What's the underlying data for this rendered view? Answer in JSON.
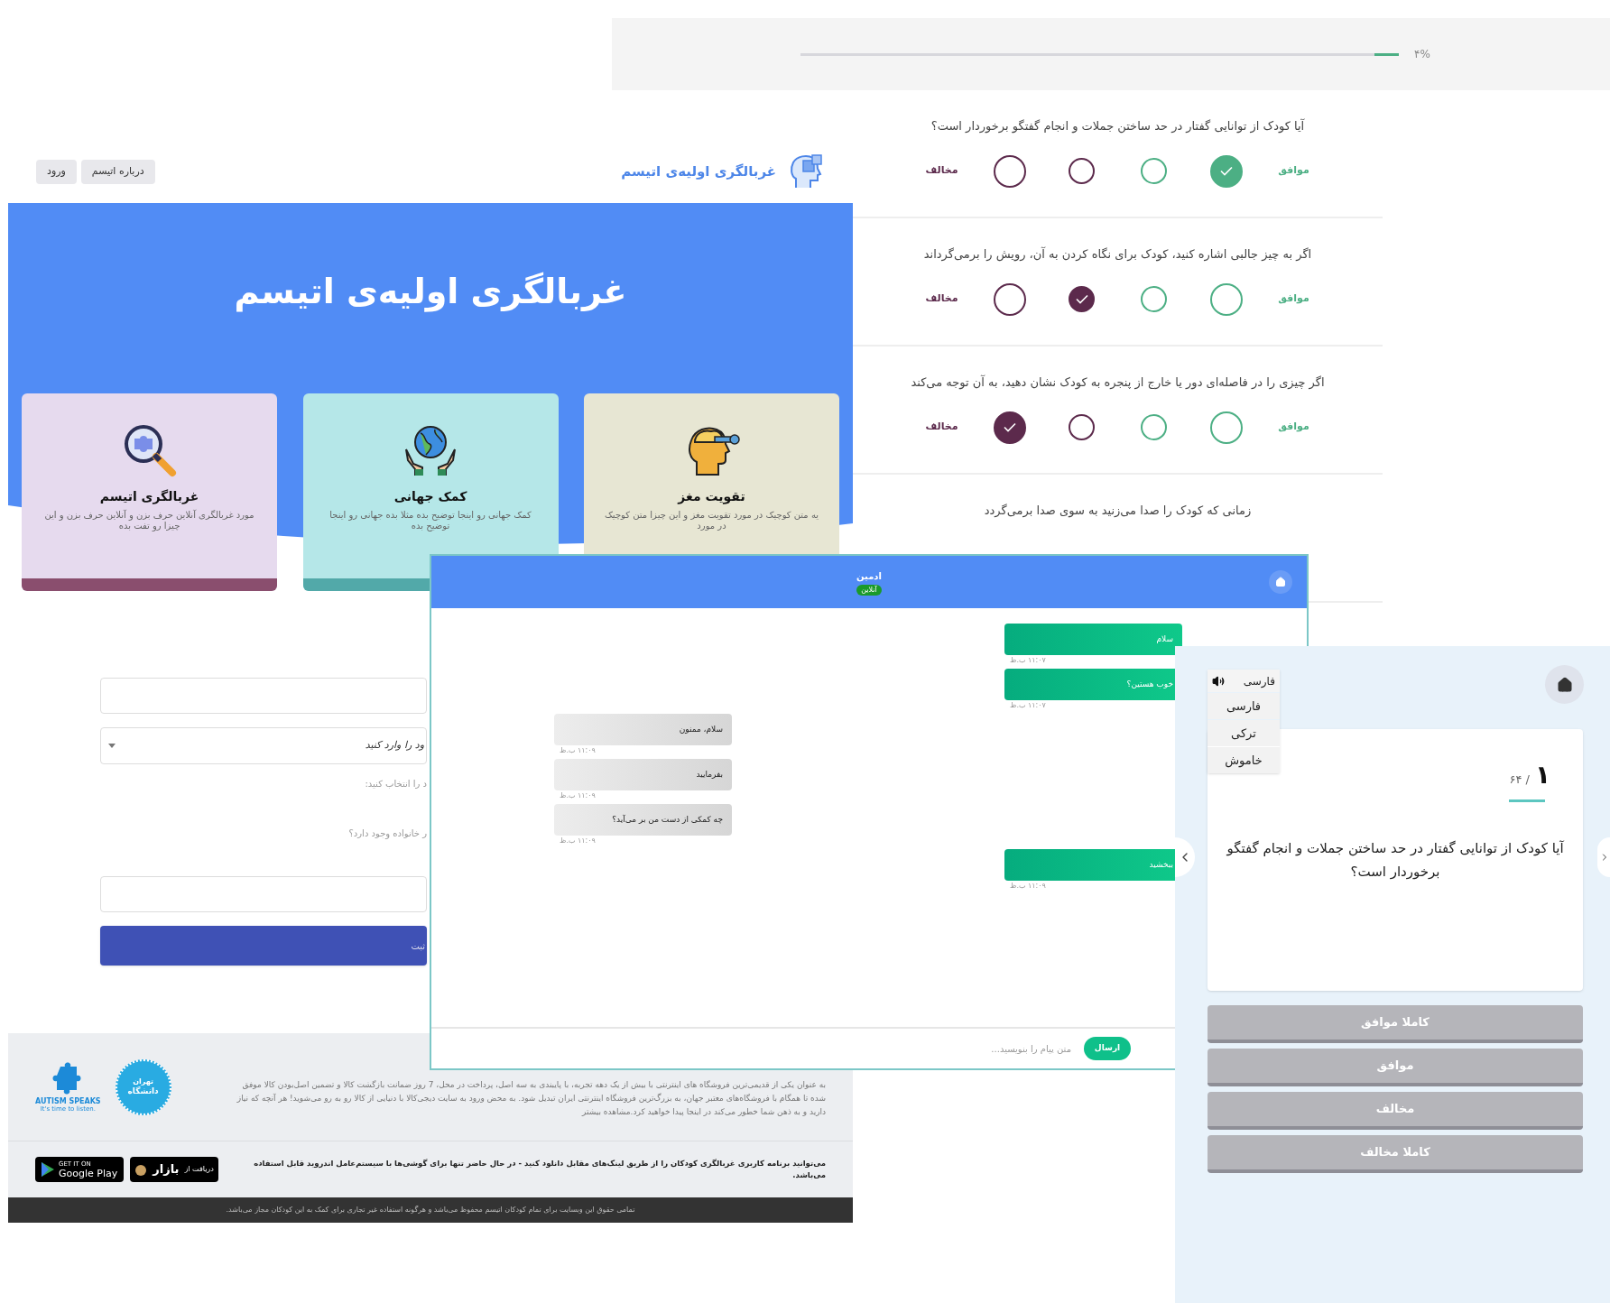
{
  "survey": {
    "progress": {
      "level": 0.04,
      "reading": "۴%"
    },
    "questions": [
      {
        "text": "آیا کودک از توانایی گفتار در حد ساختن جملات و انجام گفتگو برخوردار است؟",
        "agree_label": "موافق",
        "disagree_label": "مخالف",
        "options": [
          {
            "selected": false
          },
          {
            "selected": false
          },
          {
            "selected": false
          },
          {
            "selected": true
          }
        ]
      },
      {
        "text": "اگر به چیز جالبی اشاره کنید، کودک برای نگاه کردن به آن، رویش را برمی‌گرداند",
        "agree_label": "موافق",
        "disagree_label": "مخالف",
        "options": [
          {
            "selected": false
          },
          {
            "selected": true
          },
          {
            "selected": false
          },
          {
            "selected": false
          }
        ]
      },
      {
        "text": "اگر چیزی را در فاصله‌ای دور یا خارج از پنجره به کودک نشان دهید، به آن توجه می‌کند",
        "agree_label": "موافق",
        "disagree_label": "مخالف",
        "options": [
          {
            "selected": true
          },
          {
            "selected": false
          },
          {
            "selected": false
          },
          {
            "selected": false
          }
        ]
      },
      {
        "text": "زمانی که کودک را صدا می‌زنید به سوی صدا برمی‌گردد"
      }
    ]
  },
  "landing": {
    "brand": "غربالگری اولیه‌ی اتیسم",
    "nav": [
      "درباره اتیسم",
      "ورود"
    ],
    "hero_title": "غربالگری اولیه‌ی اتیسم",
    "cards": [
      {
        "kind": "head",
        "title": "تقویت مغز",
        "text": "یه متن کوچیک در مورد تقویت مغز و این چیزا متن کوچیک در مورد"
      },
      {
        "kind": "globe",
        "title": "کمک جهانی",
        "text": "کمک جهانی رو اینجا توضیح بده مثلا بده جهانی رو اینجا توضیح بده"
      },
      {
        "kind": "magnifier",
        "title": "غربالگری اتیسم",
        "text": "مورد غربالگری آنلاین حرف بزن و آنلاین حرف بزن و این چیزا رو تفت بده"
      }
    ],
    "form": {
      "select_placeholder": "ود را وارد کنید",
      "choose_label": "د را انتخاب کنید:",
      "family_question": "ر خانواده وجود دارد؟",
      "submit": "ثبت"
    },
    "footer": {
      "about": "به عنوان یکی از قدیمی‌ترین فروشگاه های اینترنتی با بیش از یک دهه تجربه، با پایبندی به سه اصل، پرداخت در محل، 7 روز ضمانت بازگشت کالا و تضمین اصل‌بودن کالا موفق شده تا همگام با فروشگاه‌های معتبر جهان، به بزرگ‌ترین فروشگاه اینترنتی ایران تبدیل شود. به محض ورود به سایت دیجی‌کالا با دنیایی از کالا رو به رو می‌شوید! هر آنچه که نیاز دارید و به ذهن شما خطور می‌کند در اینجا پیدا خواهید کرد.مشاهده بیشتر",
      "university_logo": [
        "تهران",
        "دانشگاه"
      ],
      "autism_logo": [
        "AUTISM SPEAKS",
        "It's time to listen."
      ],
      "download_text": "می‌توانید برنامه کاربری غربالگری کودکان را از طریق لینک‌های مقابل دانلود کنید - در حال حاضر تنها برای گوشی‌ها با سیستم‌عامل اندروید قابل استفاده می‌باشد.",
      "bazaar_badge": [
        "دریافت از",
        "بازار"
      ],
      "google_badge": [
        "GET IT ON",
        "Google Play"
      ],
      "copyright": "تمامی حقوق این وبسایت برای تمام کودکان اتیسم محفوظ می‌باشد و هرگونه استفاده غیر تجاری برای کمک به این کودکان مجاز می‌باشد."
    }
  },
  "chat": {
    "name": "ادمین",
    "status": "آنلاین",
    "messages": [
      {
        "kind": "sent",
        "text": "سلام",
        "time": "۱۱:۰۷ ب.ظ"
      },
      {
        "kind": "sent",
        "text": "خوب هستین؟",
        "time": "۱۱:۰۷ ب.ظ"
      },
      {
        "kind": "received",
        "text": "سلام، ممنون",
        "time": "۱۱:۰۹ ب.ظ"
      },
      {
        "kind": "received",
        "text": "بفرمایید",
        "time": "۱۱:۰۹ ب.ظ"
      },
      {
        "kind": "received",
        "text": "چه کمکی از دست من بر می‌آید؟",
        "time": "۱۱:۰۹ ب.ظ"
      },
      {
        "kind": "sent",
        "text": "ببخشید",
        "time": "۱۱:۰۹ ب.ظ"
      }
    ],
    "input_placeholder": "متن پیام را بنویسید...",
    "send": "ارسال"
  },
  "mobile": {
    "language": {
      "current": "فارسی",
      "options": [
        "فارسی",
        "ترکی",
        "خاموش"
      ]
    },
    "number": "۱",
    "total": "/ ۶۴",
    "question": "آیا کودک از توانایی گفتار در حد ساختن جملات و انجام گفتگو برخوردار است؟",
    "answers": [
      "کاملا موافق",
      "موافق",
      "مخالف",
      "کاملا مخالف"
    ]
  }
}
